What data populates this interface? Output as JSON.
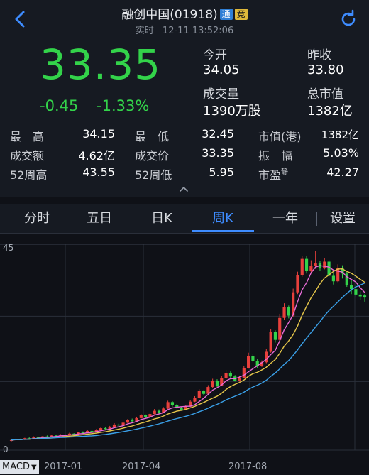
{
  "header": {
    "title": "融创中国(01918)",
    "badge_tong": "通",
    "badge_jing": "竞",
    "status": "实时",
    "datetime": "12-11 13:52:06"
  },
  "quote": {
    "price": "33.35",
    "change": "-0.45",
    "change_pct": "-1.33%",
    "open_label": "今开",
    "open": "34.05",
    "prev_close_label": "昨收",
    "prev_close": "33.80",
    "volume_label": "成交量",
    "volume": "1390万股",
    "mktcap_label": "总市值",
    "mktcap": "1382亿"
  },
  "stats": {
    "high_label": "最　高",
    "high": "34.15",
    "low_label": "最　低",
    "low": "32.45",
    "hk_mktcap_label": "市值(港)",
    "hk_mktcap": "1382亿",
    "turnover_label": "成交额",
    "turnover": "4.62亿",
    "deal_price_label": "成交价",
    "deal_price": "33.35",
    "amplitude_label": "振　幅",
    "amplitude": "5.03%",
    "w52_high_label": "52周高",
    "w52_high": "43.55",
    "w52_low_label": "52周低",
    "w52_low": "5.95",
    "pe_label": "市盈",
    "pe_sup": "静",
    "pe": "42.27"
  },
  "tabs": [
    "分时",
    "五日",
    "日K",
    "周K",
    "一年",
    "设置"
  ],
  "active_tab": "周K",
  "colors": {
    "up": "#e8403c",
    "down": "#33d34a",
    "ma_short": "#e86ad6",
    "ma_mid": "#e5c64a",
    "ma_long": "#3aa0e8",
    "accent": "#3e8cff"
  },
  "indicator": "MACD",
  "chart_data": {
    "type": "candlestick",
    "y_max_label": "45",
    "y_min_label": "0",
    "ylim": [
      0,
      45
    ],
    "x_ticks": [
      "2017-01",
      "2017-04",
      "2017-08"
    ],
    "candles": [
      [
        2.1,
        2.2,
        1.9,
        2.3
      ],
      [
        2.2,
        2.4,
        2.1,
        2.5
      ],
      [
        2.4,
        2.3,
        2.2,
        2.5
      ],
      [
        2.3,
        2.6,
        2.2,
        2.7
      ],
      [
        2.6,
        2.5,
        2.4,
        2.8
      ],
      [
        2.5,
        2.8,
        2.4,
        3.0
      ],
      [
        2.8,
        2.7,
        2.6,
        2.9
      ],
      [
        2.7,
        3.0,
        2.6,
        3.1
      ],
      [
        3.0,
        2.9,
        2.8,
        3.2
      ],
      [
        2.9,
        3.2,
        2.8,
        3.3
      ],
      [
        3.2,
        3.1,
        3.0,
        3.4
      ],
      [
        3.1,
        3.4,
        3.0,
        3.5
      ],
      [
        3.4,
        3.3,
        3.2,
        3.6
      ],
      [
        3.3,
        3.6,
        3.2,
        3.8
      ],
      [
        3.6,
        3.5,
        3.4,
        3.7
      ],
      [
        3.5,
        3.9,
        3.4,
        4.0
      ],
      [
        3.9,
        3.8,
        3.6,
        4.1
      ],
      [
        3.8,
        4.2,
        3.7,
        4.4
      ],
      [
        4.2,
        4.0,
        3.9,
        4.3
      ],
      [
        4.0,
        4.4,
        3.9,
        4.6
      ],
      [
        4.4,
        4.8,
        4.3,
        5.0
      ],
      [
        4.8,
        4.6,
        4.5,
        5.0
      ],
      [
        4.6,
        5.1,
        4.5,
        5.3
      ],
      [
        5.1,
        5.6,
        5.0,
        5.9
      ],
      [
        5.6,
        5.4,
        5.2,
        5.8
      ],
      [
        5.4,
        6.0,
        5.3,
        6.2
      ],
      [
        6.0,
        6.6,
        5.9,
        6.8
      ],
      [
        6.6,
        6.3,
        6.1,
        6.9
      ],
      [
        6.3,
        7.0,
        6.2,
        7.3
      ],
      [
        7.0,
        7.6,
        6.9,
        7.9
      ],
      [
        7.6,
        7.2,
        7.0,
        7.8
      ],
      [
        7.2,
        7.9,
        7.1,
        8.2
      ],
      [
        7.9,
        8.6,
        7.8,
        9.0
      ],
      [
        8.6,
        8.2,
        8.0,
        8.9
      ],
      [
        8.2,
        9.1,
        8.1,
        9.4
      ],
      [
        9.1,
        10.5,
        9.0,
        10.8
      ],
      [
        10.5,
        9.8,
        9.5,
        10.7
      ],
      [
        9.8,
        9.3,
        9.1,
        10.1
      ],
      [
        9.3,
        8.8,
        8.6,
        9.5
      ],
      [
        8.8,
        9.5,
        8.7,
        9.8
      ],
      [
        9.5,
        10.6,
        9.4,
        10.9
      ],
      [
        10.6,
        11.4,
        10.5,
        11.8
      ],
      [
        11.4,
        12.9,
        11.3,
        13.3
      ],
      [
        12.9,
        12.3,
        12.0,
        13.1
      ],
      [
        12.3,
        13.8,
        12.2,
        14.2
      ],
      [
        13.8,
        15.2,
        13.6,
        15.6
      ],
      [
        15.2,
        14.1,
        13.8,
        15.5
      ],
      [
        14.1,
        15.8,
        14.0,
        16.2
      ],
      [
        15.8,
        16.9,
        15.5,
        17.5
      ],
      [
        16.9,
        16.1,
        15.8,
        17.2
      ],
      [
        16.1,
        15.2,
        15.0,
        16.4
      ],
      [
        15.2,
        15.8,
        15.0,
        16.3
      ],
      [
        15.8,
        17.9,
        15.7,
        18.4
      ],
      [
        17.9,
        20.6,
        17.8,
        21.3
      ],
      [
        20.6,
        19.5,
        19.2,
        21.0
      ],
      [
        19.5,
        18.4,
        18.0,
        19.9
      ],
      [
        18.4,
        19.2,
        18.2,
        19.6
      ],
      [
        19.2,
        21.5,
        19.0,
        22.1
      ],
      [
        21.5,
        25.8,
        21.3,
        26.5
      ],
      [
        25.8,
        24.1,
        23.5,
        26.2
      ],
      [
        24.1,
        28.9,
        24.0,
        29.8
      ],
      [
        28.9,
        31.2,
        28.5,
        32.1
      ],
      [
        31.2,
        29.4,
        28.8,
        31.6
      ],
      [
        29.4,
        34.5,
        29.2,
        35.3
      ],
      [
        34.5,
        38.2,
        34.1,
        39.0
      ],
      [
        38.2,
        41.8,
        37.9,
        42.5
      ],
      [
        41.8,
        39.1,
        38.6,
        42.4
      ],
      [
        39.1,
        40.2,
        38.7,
        41.5
      ],
      [
        40.2,
        40.8,
        39.6,
        43.55
      ],
      [
        40.8,
        39.7,
        39.2,
        41.3
      ],
      [
        39.7,
        41.2,
        39.5,
        42.0
      ],
      [
        41.2,
        38.1,
        37.8,
        41.6
      ],
      [
        38.1,
        36.9,
        36.2,
        38.8
      ],
      [
        36.9,
        39.8,
        36.7,
        40.6
      ],
      [
        39.8,
        38.6,
        37.5,
        40.4
      ],
      [
        38.6,
        36.1,
        35.7,
        39.0
      ],
      [
        36.1,
        35.2,
        34.1,
        37.3
      ],
      [
        35.2,
        34.0,
        33.6,
        36.0
      ],
      [
        34.0,
        33.6,
        32.8,
        34.7
      ],
      [
        33.8,
        33.35,
        32.45,
        34.15
      ]
    ]
  }
}
